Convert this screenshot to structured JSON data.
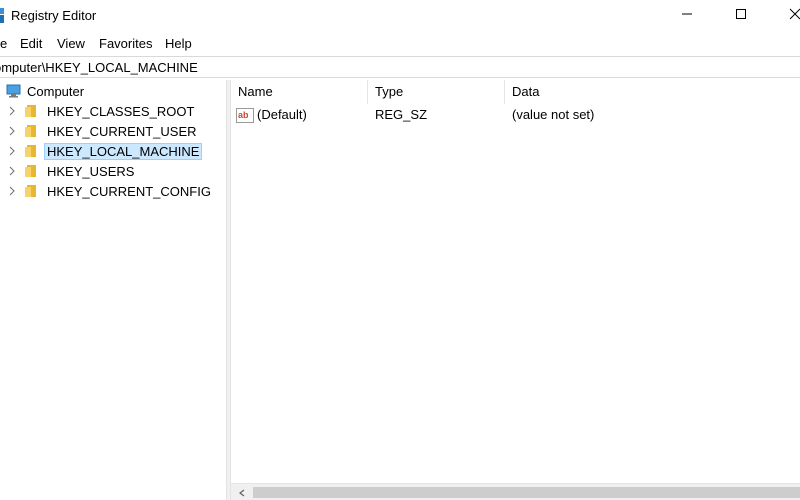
{
  "window": {
    "title": "Registry Editor",
    "app_icon": "registry-icon",
    "controls": [
      "minimize-icon",
      "maximize-icon",
      "close-icon"
    ]
  },
  "menu": {
    "file": "e",
    "edit": "Edit",
    "view": "View",
    "favorites": "Favorites",
    "help": "Help"
  },
  "address": {
    "value": "omputer\\HKEY_LOCAL_MACHINE"
  },
  "tree": {
    "root": {
      "label": "Computer",
      "icon": "computer-icon"
    },
    "items": [
      {
        "label": "HKEY_CLASSES_ROOT",
        "icon": "folder-icon",
        "selected": false
      },
      {
        "label": "HKEY_CURRENT_USER",
        "icon": "folder-icon",
        "selected": false
      },
      {
        "label": "HKEY_LOCAL_MACHINE",
        "icon": "folder-icon",
        "selected": true
      },
      {
        "label": "HKEY_USERS",
        "icon": "folder-icon",
        "selected": false
      },
      {
        "label": "HKEY_CURRENT_CONFIG",
        "icon": "folder-icon",
        "selected": false
      }
    ]
  },
  "list": {
    "columns": {
      "name": "Name",
      "type": "Type",
      "data": "Data"
    },
    "rows": [
      {
        "name": "(Default)",
        "type": "REG_SZ",
        "data": "(value not set)",
        "icon": "string-value-icon"
      }
    ]
  },
  "colors": {
    "selection_bg": "#cce8ff",
    "selection_border": "#99d1ff",
    "folder": "#e8b730"
  }
}
